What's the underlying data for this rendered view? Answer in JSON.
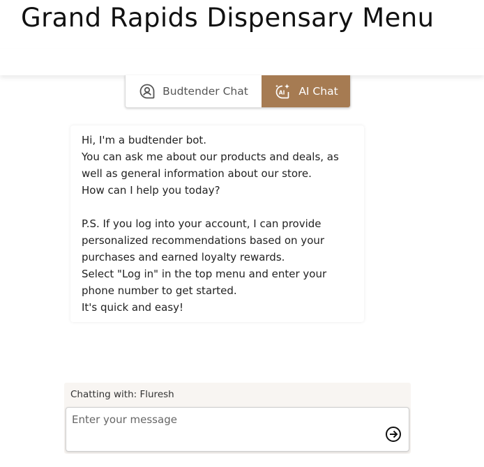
{
  "header": {
    "title": "Grand Rapids Dispensary Menu"
  },
  "tabs": [
    {
      "label": "Budtender Chat",
      "icon": "person-chat-icon",
      "active": false
    },
    {
      "label": "AI Chat",
      "icon": "ai-chat-icon",
      "active": true
    }
  ],
  "colors": {
    "accent": "#a67b52"
  },
  "bot_message": {
    "lines_1": [
      "Hi, I'm a budtender bot.",
      "You can ask me about our products and deals, as",
      "well as general information about our store.",
      "How can I help you today?"
    ],
    "lines_2": [
      "P.S. If you log into your account, I can provide",
      "personalized recommendations based on your",
      "purchases and earned loyalty rewards.",
      "Select \"Log in\" in the top menu and enter your",
      "phone number to get started.",
      "It's quick and easy!"
    ]
  },
  "composer": {
    "chatting_with": "Chatting with: Fluresh",
    "placeholder": "Enter your message",
    "value": "",
    "send_icon": "arrow-right-circle-icon"
  }
}
